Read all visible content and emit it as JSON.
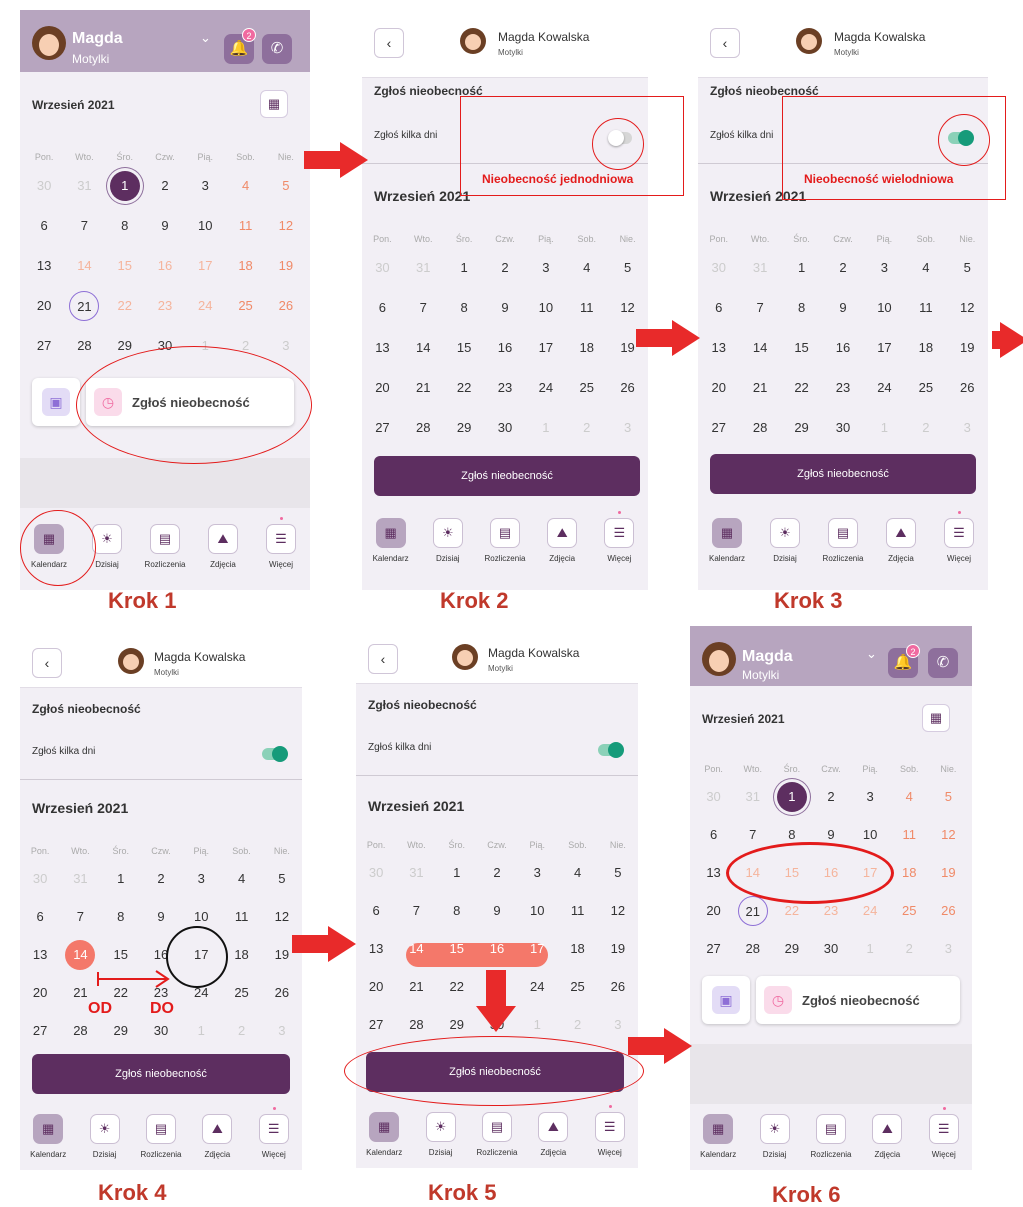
{
  "colors": {
    "accent": "#5d2e60",
    "header": "#b7a5bf",
    "weekend": "#f08a68",
    "absence": "#f4786a",
    "toggle_on": "#169b7a",
    "annotation": "#e31b1b"
  },
  "main_header": {
    "name": "Magda",
    "group": "Motylki",
    "notifications": "2"
  },
  "report_header": {
    "name": "Magda Kowalska",
    "group": "Motylki",
    "back": "‹"
  },
  "month": "Wrzesień 2021",
  "weekdays": [
    "Pon.",
    "Wto.",
    "Śro.",
    "Czw.",
    "Pią.",
    "Sob.",
    "Nie."
  ],
  "form": {
    "title": "Zgłoś nieobecność",
    "toggle_label": "Zgłoś kilka dni",
    "submit": "Zgłoś nieobecność"
  },
  "action_label": "Zgłoś nieobecność",
  "nav": [
    "Kalendarz",
    "Dzisiaj",
    "Rozliczenia",
    "Zdjęcia",
    "Więcej"
  ],
  "annotations": {
    "single": "Nieobecność jednodniowa",
    "multi": "Nieobecność wielodniowa",
    "from": "OD",
    "to": "DO"
  },
  "steps": [
    "Krok 1",
    "Krok 2",
    "Krok 3",
    "Krok 4",
    "Krok 5",
    "Krok 6"
  ]
}
